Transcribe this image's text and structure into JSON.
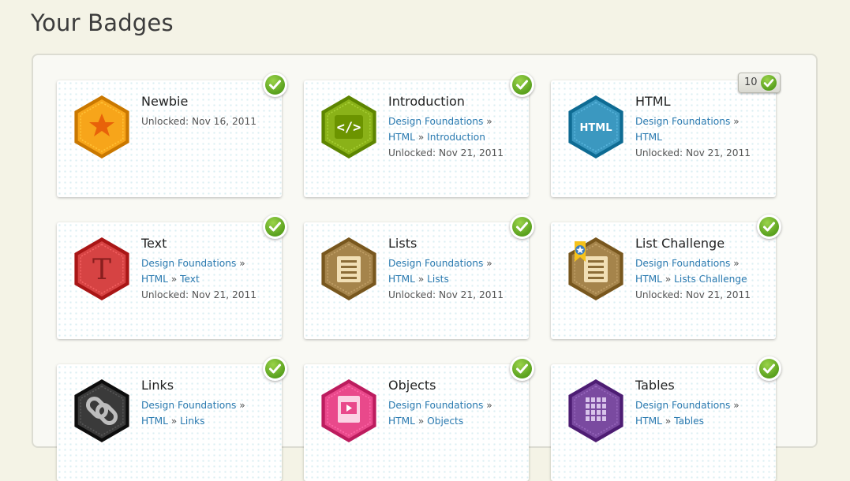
{
  "page": {
    "title": "Your Badges"
  },
  "badges": [
    {
      "name": "Newbie",
      "lines": [
        [
          {
            "type": "text",
            "text": "Unlocked: Nov 16, 2011"
          }
        ]
      ],
      "icon": "star-icon",
      "color": "#f7a51a",
      "check": "check"
    },
    {
      "name": "Introduction",
      "lines": [
        [
          {
            "type": "link",
            "text": "Design Foundations"
          },
          {
            "type": "sep",
            "text": " »"
          }
        ],
        [
          {
            "type": "link",
            "text": "HTML"
          },
          {
            "type": "sep",
            "text": " » "
          },
          {
            "type": "link",
            "text": "Introduction"
          }
        ],
        [
          {
            "type": "text",
            "text": "Unlocked: Nov 21, 2011"
          }
        ]
      ],
      "icon": "code-icon",
      "color": "#8ab218",
      "check": "check"
    },
    {
      "name": "HTML",
      "lines": [
        [
          {
            "type": "link",
            "text": "Design Foundations"
          },
          {
            "type": "sep",
            "text": " »"
          }
        ],
        [
          {
            "type": "link",
            "text": "HTML"
          }
        ],
        [
          {
            "type": "text",
            "text": "Unlocked: Nov 21, 2011"
          }
        ]
      ],
      "icon": "html-icon",
      "color": "#3b98c0",
      "check": "count",
      "count": "10"
    },
    {
      "name": "Text",
      "lines": [
        [
          {
            "type": "link",
            "text": "Design Foundations"
          },
          {
            "type": "sep",
            "text": " »"
          }
        ],
        [
          {
            "type": "link",
            "text": "HTML"
          },
          {
            "type": "sep",
            "text": " » "
          },
          {
            "type": "link",
            "text": "Text"
          }
        ],
        [
          {
            "type": "text",
            "text": "Unlocked: Nov 21, 2011"
          }
        ]
      ],
      "icon": "letter-t-icon",
      "color": "#d64343",
      "check": "check"
    },
    {
      "name": "Lists",
      "lines": [
        [
          {
            "type": "link",
            "text": "Design Foundations"
          },
          {
            "type": "sep",
            "text": " »"
          }
        ],
        [
          {
            "type": "link",
            "text": "HTML"
          },
          {
            "type": "sep",
            "text": " » "
          },
          {
            "type": "link",
            "text": "Lists"
          }
        ],
        [
          {
            "type": "text",
            "text": "Unlocked: Nov 21, 2011"
          }
        ]
      ],
      "icon": "list-icon",
      "color": "#a5844b",
      "check": "check"
    },
    {
      "name": "List Challenge",
      "lines": [
        [
          {
            "type": "link",
            "text": "Design Foundations"
          },
          {
            "type": "sep",
            "text": " »"
          }
        ],
        [
          {
            "type": "link",
            "text": "HTML"
          },
          {
            "type": "sep",
            "text": " » "
          },
          {
            "type": "link",
            "text": "Lists Challenge"
          }
        ],
        [
          {
            "type": "text",
            "text": "Unlocked: Nov 21, 2011"
          }
        ]
      ],
      "icon": "list-ribbon-icon",
      "color": "#a5844b",
      "check": "check"
    },
    {
      "name": "Links",
      "lines": [
        [
          {
            "type": "link",
            "text": "Design Foundations"
          },
          {
            "type": "sep",
            "text": " »"
          }
        ],
        [
          {
            "type": "link",
            "text": "HTML"
          },
          {
            "type": "sep",
            "text": " » "
          },
          {
            "type": "link",
            "text": "Links"
          }
        ]
      ],
      "icon": "chain-link-icon",
      "color": "#3a3a3a",
      "check": "check"
    },
    {
      "name": "Objects",
      "lines": [
        [
          {
            "type": "link",
            "text": "Design Foundations"
          },
          {
            "type": "sep",
            "text": " »"
          }
        ],
        [
          {
            "type": "link",
            "text": "HTML"
          },
          {
            "type": "sep",
            "text": " » "
          },
          {
            "type": "link",
            "text": "Objects"
          }
        ]
      ],
      "icon": "media-icon",
      "color": "#e9498b",
      "check": "check"
    },
    {
      "name": "Tables",
      "lines": [
        [
          {
            "type": "link",
            "text": "Design Foundations"
          },
          {
            "type": "sep",
            "text": " »"
          }
        ],
        [
          {
            "type": "link",
            "text": "HTML"
          },
          {
            "type": "sep",
            "text": " » "
          },
          {
            "type": "link",
            "text": "Tables"
          }
        ]
      ],
      "icon": "table-grid-icon",
      "color": "#7a4aa0",
      "check": "check"
    }
  ]
}
